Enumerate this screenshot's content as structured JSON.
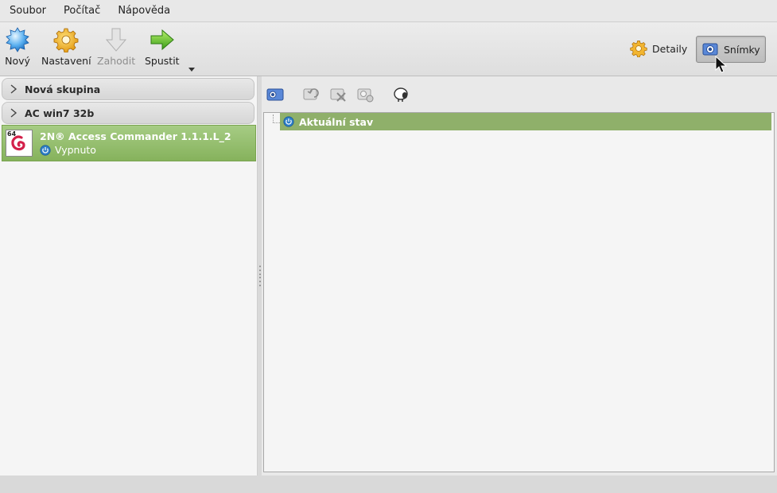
{
  "menu": {
    "items": [
      {
        "label": "Soubor"
      },
      {
        "label": "Počítač"
      },
      {
        "label": "Nápověda"
      }
    ]
  },
  "toolbar": {
    "new_label": "Nový",
    "settings_label": "Nastavení",
    "discard_label": "Zahodit",
    "start_label": "Spustit",
    "details_label": "Detaily",
    "snapshots_label": "Snímky"
  },
  "vm_list": {
    "groups": [
      {
        "label": "Nová skupina"
      },
      {
        "label": "AC win7 32b"
      }
    ],
    "selected_vm": {
      "name": "2N® Access Commander 1.1.1.L_2",
      "state": "Vypnuto",
      "arch_badge": "64"
    }
  },
  "snapshots": {
    "current_state_label": "Aktuální stav"
  },
  "colors": {
    "selection_green": "#8fb06a",
    "power_icon_blue": "#2f7fc7"
  }
}
